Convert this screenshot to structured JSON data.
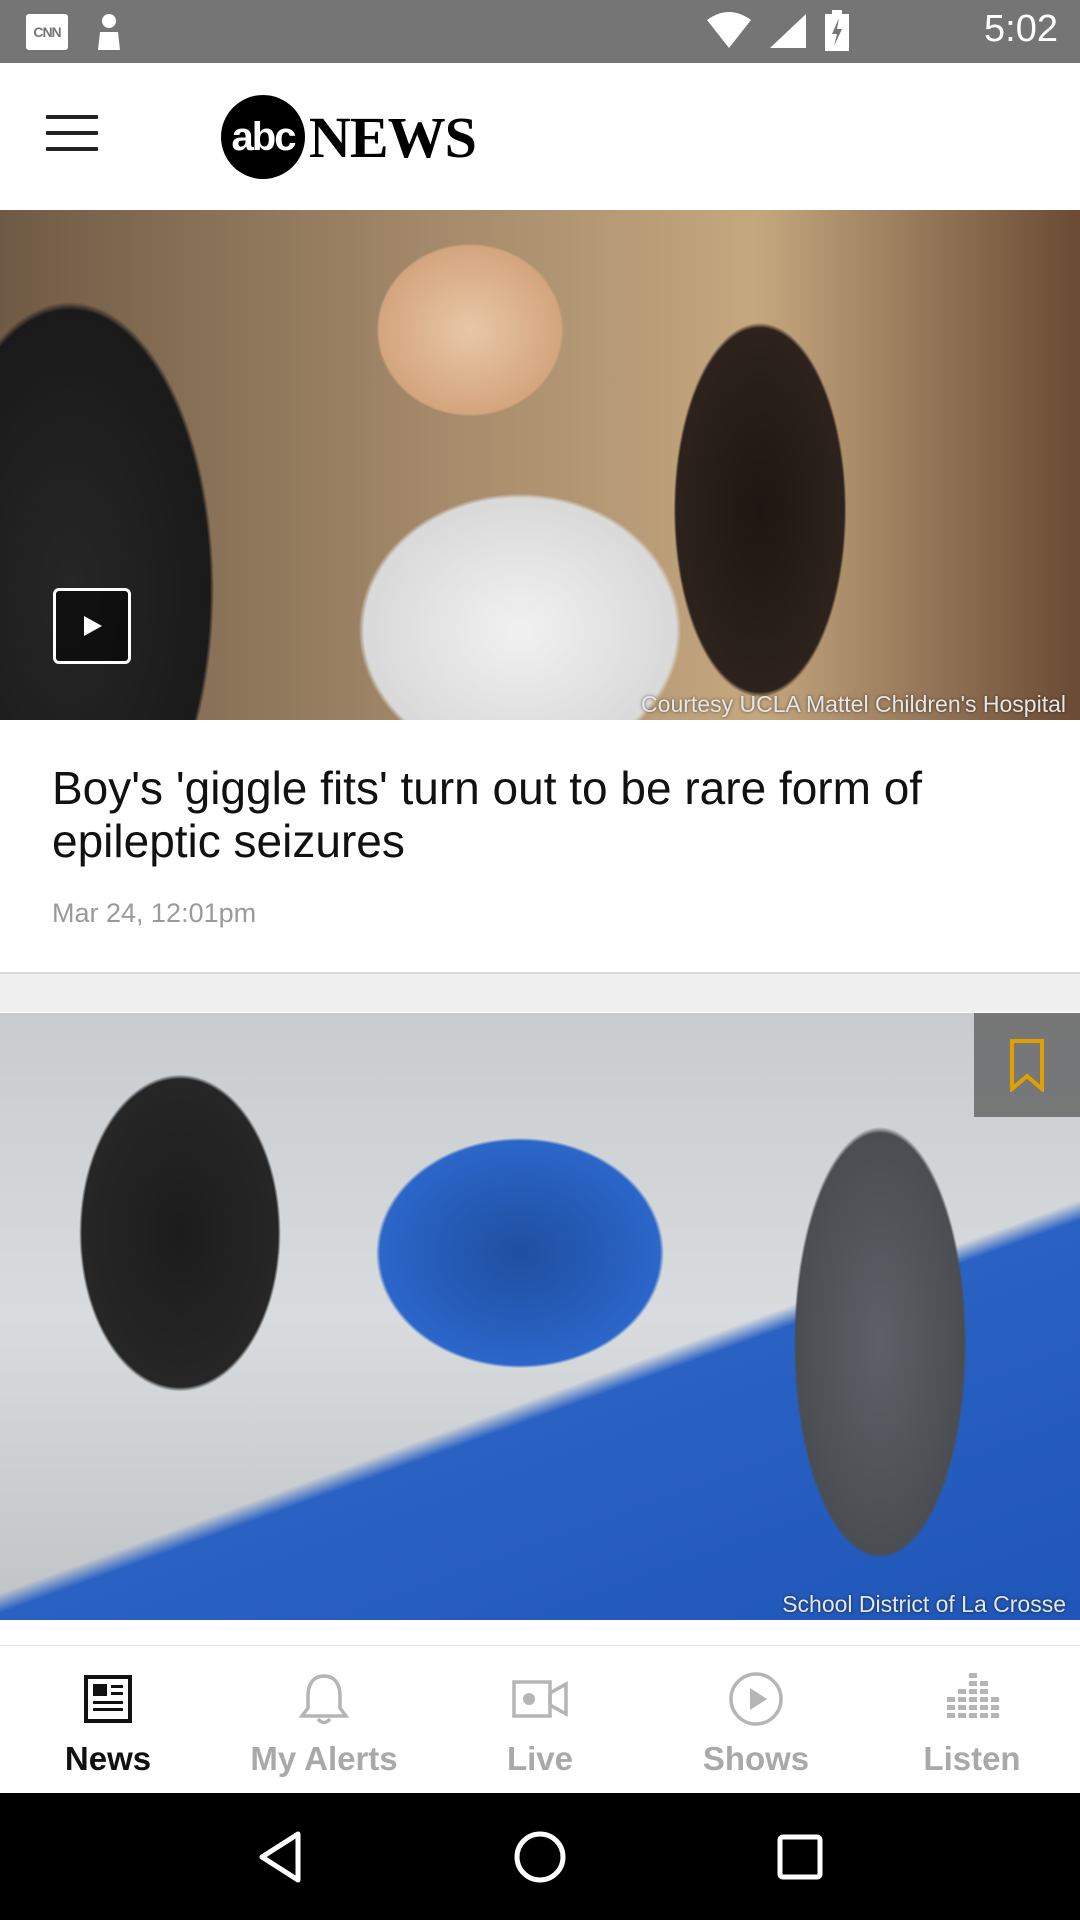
{
  "status_bar": {
    "time": "5:02",
    "notification_icons": [
      "cnn-icon",
      "notification-icon"
    ],
    "system_icons": [
      "wifi-icon",
      "signal-icon",
      "battery-charging-icon"
    ],
    "cnn_badge": "CNN"
  },
  "header": {
    "logo_circle_text": "abc",
    "logo_text": "NEWS"
  },
  "stories": [
    {
      "headline": "Boy's 'giggle fits' turn out to be rare form of epileptic seizures",
      "timestamp": "Mar 24, 12:01pm",
      "image_credit": "Courtesy UCLA Mattel Children's Hospital",
      "has_video": true
    },
    {
      "image_credit": "School District of La Crosse",
      "bookmark_color": "#e0a100"
    }
  ],
  "bottom_nav": {
    "items": [
      {
        "label": "News",
        "icon": "newspaper-icon",
        "active": true
      },
      {
        "label": "My Alerts",
        "icon": "bell-icon",
        "active": false
      },
      {
        "label": "Live",
        "icon": "video-camera-icon",
        "active": false
      },
      {
        "label": "Shows",
        "icon": "play-circle-icon",
        "active": false
      },
      {
        "label": "Listen",
        "icon": "audio-bars-icon",
        "active": false
      }
    ]
  },
  "system_nav": [
    "back-icon",
    "home-icon",
    "recents-icon"
  ]
}
